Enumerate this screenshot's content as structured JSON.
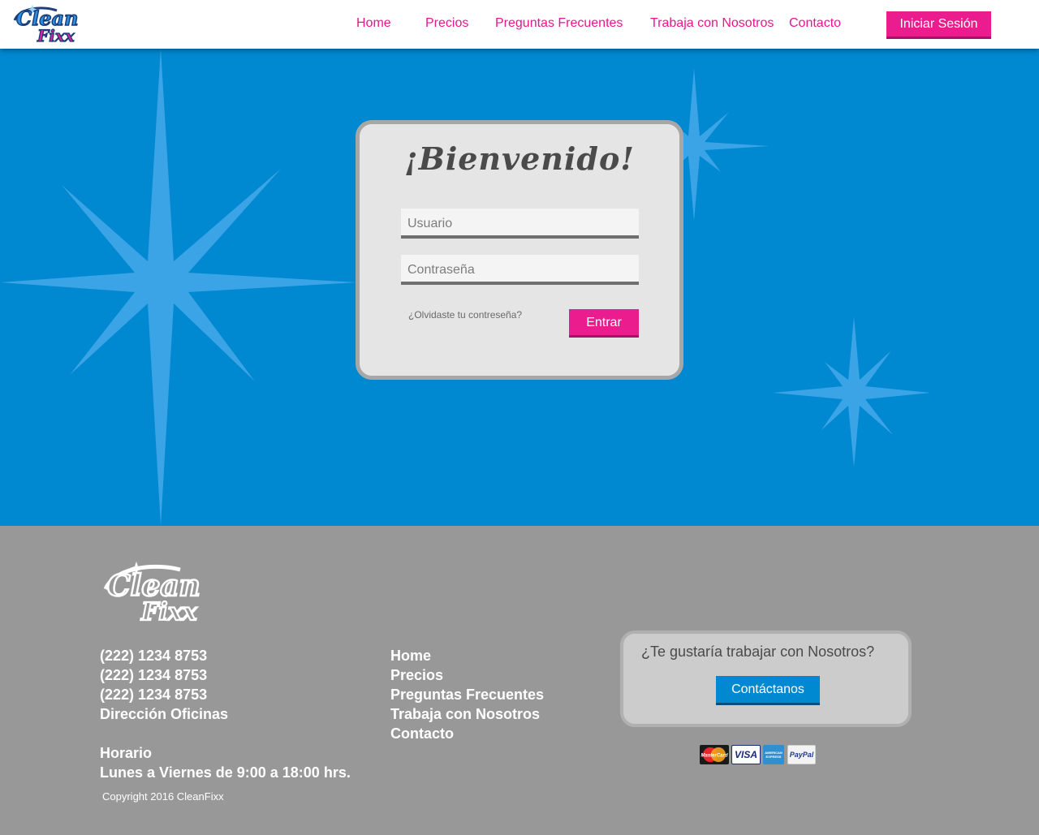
{
  "brand": {
    "logo_text_top": "Clean",
    "logo_text_bottom": "Fixx"
  },
  "nav": {
    "items": [
      {
        "label": "Home"
      },
      {
        "label": "Precios"
      },
      {
        "label": "Preguntas Frecuentes"
      },
      {
        "label": "Trabaja con Nosotros"
      },
      {
        "label": "Contacto"
      }
    ],
    "login_label": "Iniciar Sesión"
  },
  "login": {
    "title": "¡Bienvenido!",
    "username_placeholder": "Usuario",
    "password_placeholder": "Contraseña",
    "forgot_label": "¿Olvidaste tu contreseña?",
    "submit_label": "Entrar"
  },
  "footer": {
    "contact": {
      "phones": [
        "(222) 1234 8753",
        "(222) 1234 8753",
        "(222) 1234 8753"
      ],
      "address": "Dirección Oficinas",
      "hours_title": "Horario",
      "hours": "Lunes a Viernes de 9:00 a 18:00 hrs."
    },
    "links": [
      "Home",
      "Precios",
      "Preguntas Frecuentes",
      "Trabaja con Nosotros",
      "Contacto"
    ],
    "cta": {
      "question": "¿Te gustaría trabajar con Nosotros?",
      "button_label": "Contáctanos"
    },
    "payments": [
      {
        "name": "MasterCard",
        "icon": "mastercard-icon"
      },
      {
        "name": "VISA",
        "icon": "visa-icon"
      },
      {
        "name": "AMERICAN EXPRESS",
        "icon": "amex-icon"
      },
      {
        "name": "PayPal",
        "icon": "paypal-icon"
      }
    ],
    "copyright": "Copyright 2016 CleanFixx"
  },
  "colors": {
    "brand_pink": "#e8168c",
    "brand_blue": "#0088d1",
    "footer_gray": "#989898"
  }
}
